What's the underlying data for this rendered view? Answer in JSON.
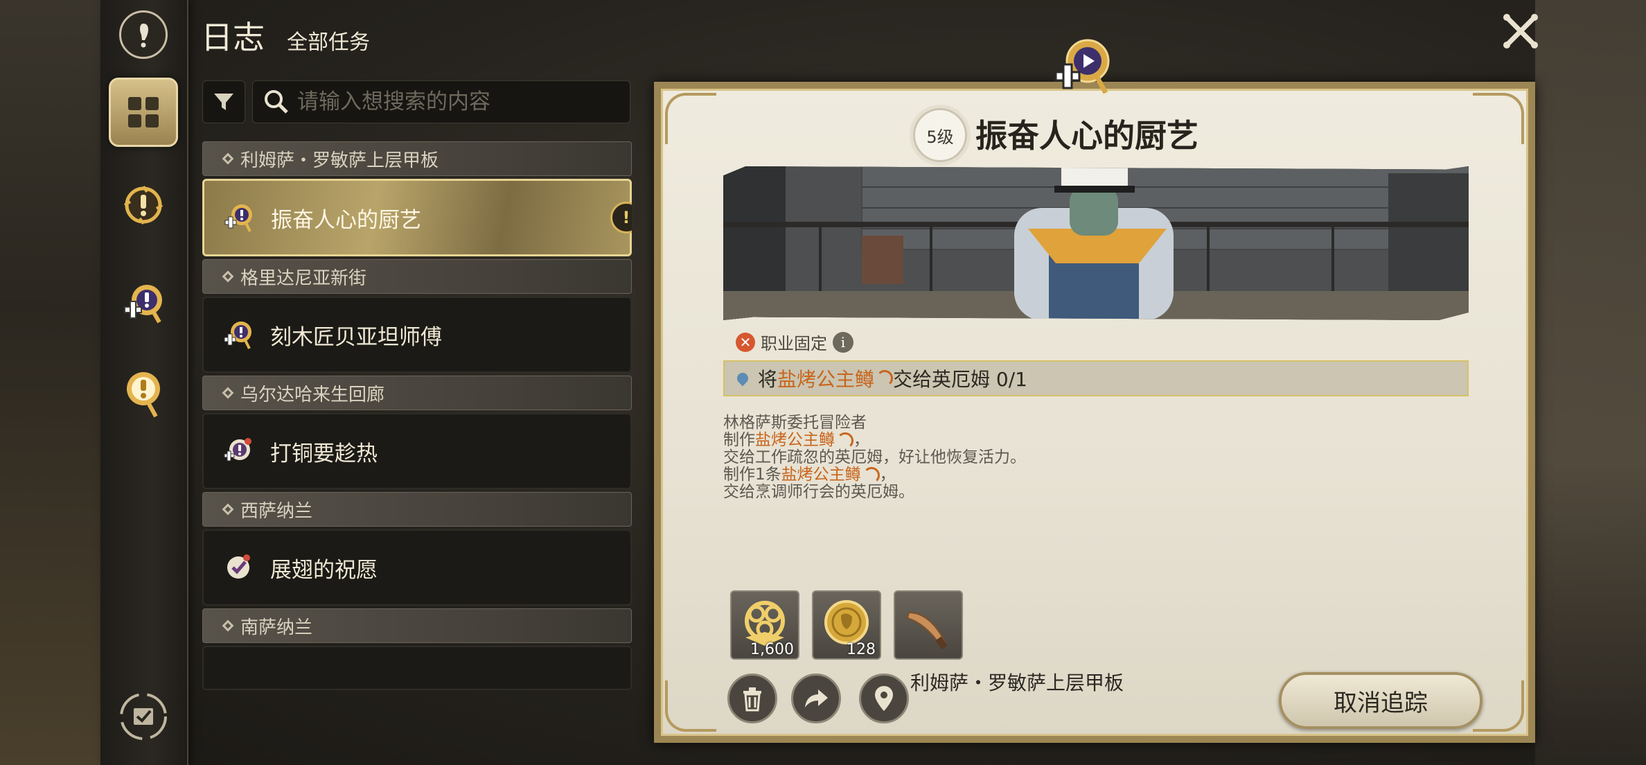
{
  "header": {
    "title": "日志",
    "subtitle": "全部任务"
  },
  "search": {
    "placeholder": "请输入想搜索的内容"
  },
  "quest_list": {
    "regions": [
      {
        "region": "利姆萨・罗敏萨上层甲板",
        "quest": "振奋人心的厨艺",
        "selected": true
      },
      {
        "region": "格里达尼亚新街",
        "quest": "刻木匠贝亚坦师傅",
        "selected": false
      },
      {
        "region": "乌尔达哈来生回廊",
        "quest": "打铜要趁热",
        "selected": false
      },
      {
        "region": "西萨纳兰",
        "quest": "展翅的祝愿",
        "selected": false
      },
      {
        "region": "南萨纳兰",
        "quest": "",
        "selected": false
      }
    ]
  },
  "detail": {
    "level": "5级",
    "title": "振奋人心的厨艺",
    "job_tag": "职业固定",
    "objective": {
      "prefix": "将",
      "item": "盐烤公主鳟",
      "suffix": "交给英厄姆 0/1"
    },
    "description": {
      "line1": "林格萨斯委托冒险者",
      "line2_prefix": "制作",
      "line2_item": "盐烤公主鳟",
      "line2_suffix": "，",
      "line3": "交给工作疏忽的英厄姆，好让他恢复活力。",
      "line4_prefix": "制作1条",
      "line4_item": "盐烤公主鳟",
      "line4_suffix": "，",
      "line5": "交给烹调师行会的英厄姆。"
    },
    "rewards": [
      {
        "icon": "experience-icon",
        "amount": "1,600"
      },
      {
        "icon": "gil-coin-icon",
        "amount": "128"
      },
      {
        "icon": "knife-item-icon",
        "amount": ""
      }
    ],
    "location": "利姆萨・罗敏萨上层甲板",
    "untrack_label": "取消追踪"
  },
  "colors": {
    "highlight": "#c8651d",
    "gold": "#d6b45a",
    "panel": "#efebde"
  }
}
